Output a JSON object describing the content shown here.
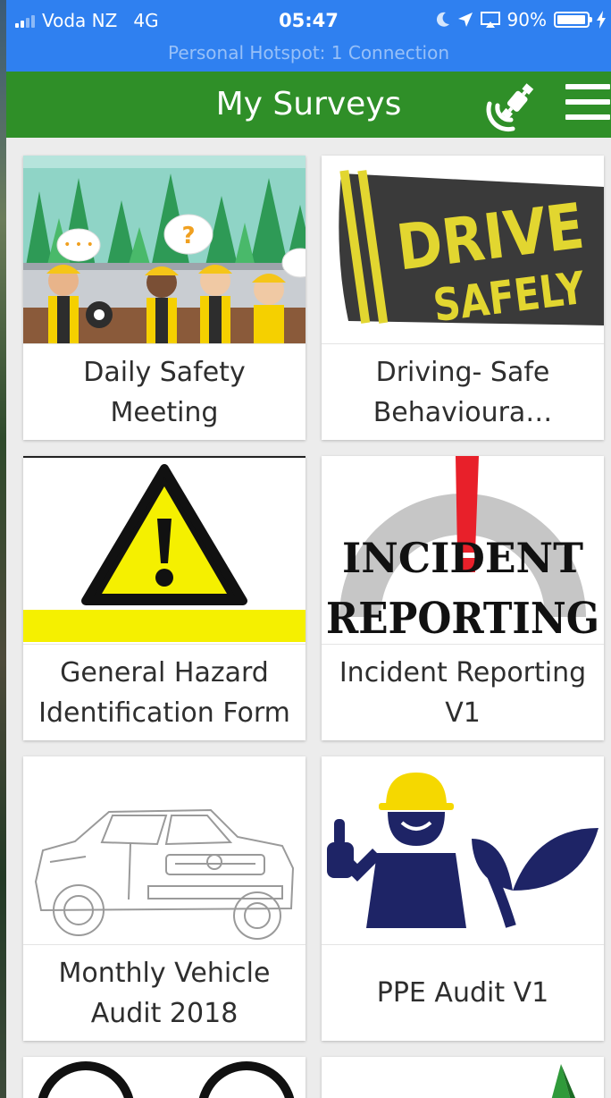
{
  "status_bar": {
    "carrier": "Voda NZ",
    "network": "4G",
    "time": "05:47",
    "battery": "90%",
    "hotspot": "Personal Hotspot: 1 Connection"
  },
  "header": {
    "title": "My Surveys",
    "icons": [
      "satellite-icon",
      "menu-icon"
    ]
  },
  "surveys": [
    {
      "title": "Daily Safety Meeting"
    },
    {
      "title": "Driving- Safe Behavioura…",
      "image_text": [
        "DRIVE",
        "SAFELY"
      ]
    },
    {
      "title": "General Hazard Identification Form"
    },
    {
      "title": "Incident Reporting V1",
      "image_text": [
        "INCIDENT",
        "REPORTING"
      ]
    },
    {
      "title": "Monthly Vehicle Audit 2018"
    },
    {
      "title": "PPE Audit V1"
    }
  ],
  "colors": {
    "status_bar": "#2f80f0",
    "header": "#2f8f28",
    "background": "#ececec"
  }
}
